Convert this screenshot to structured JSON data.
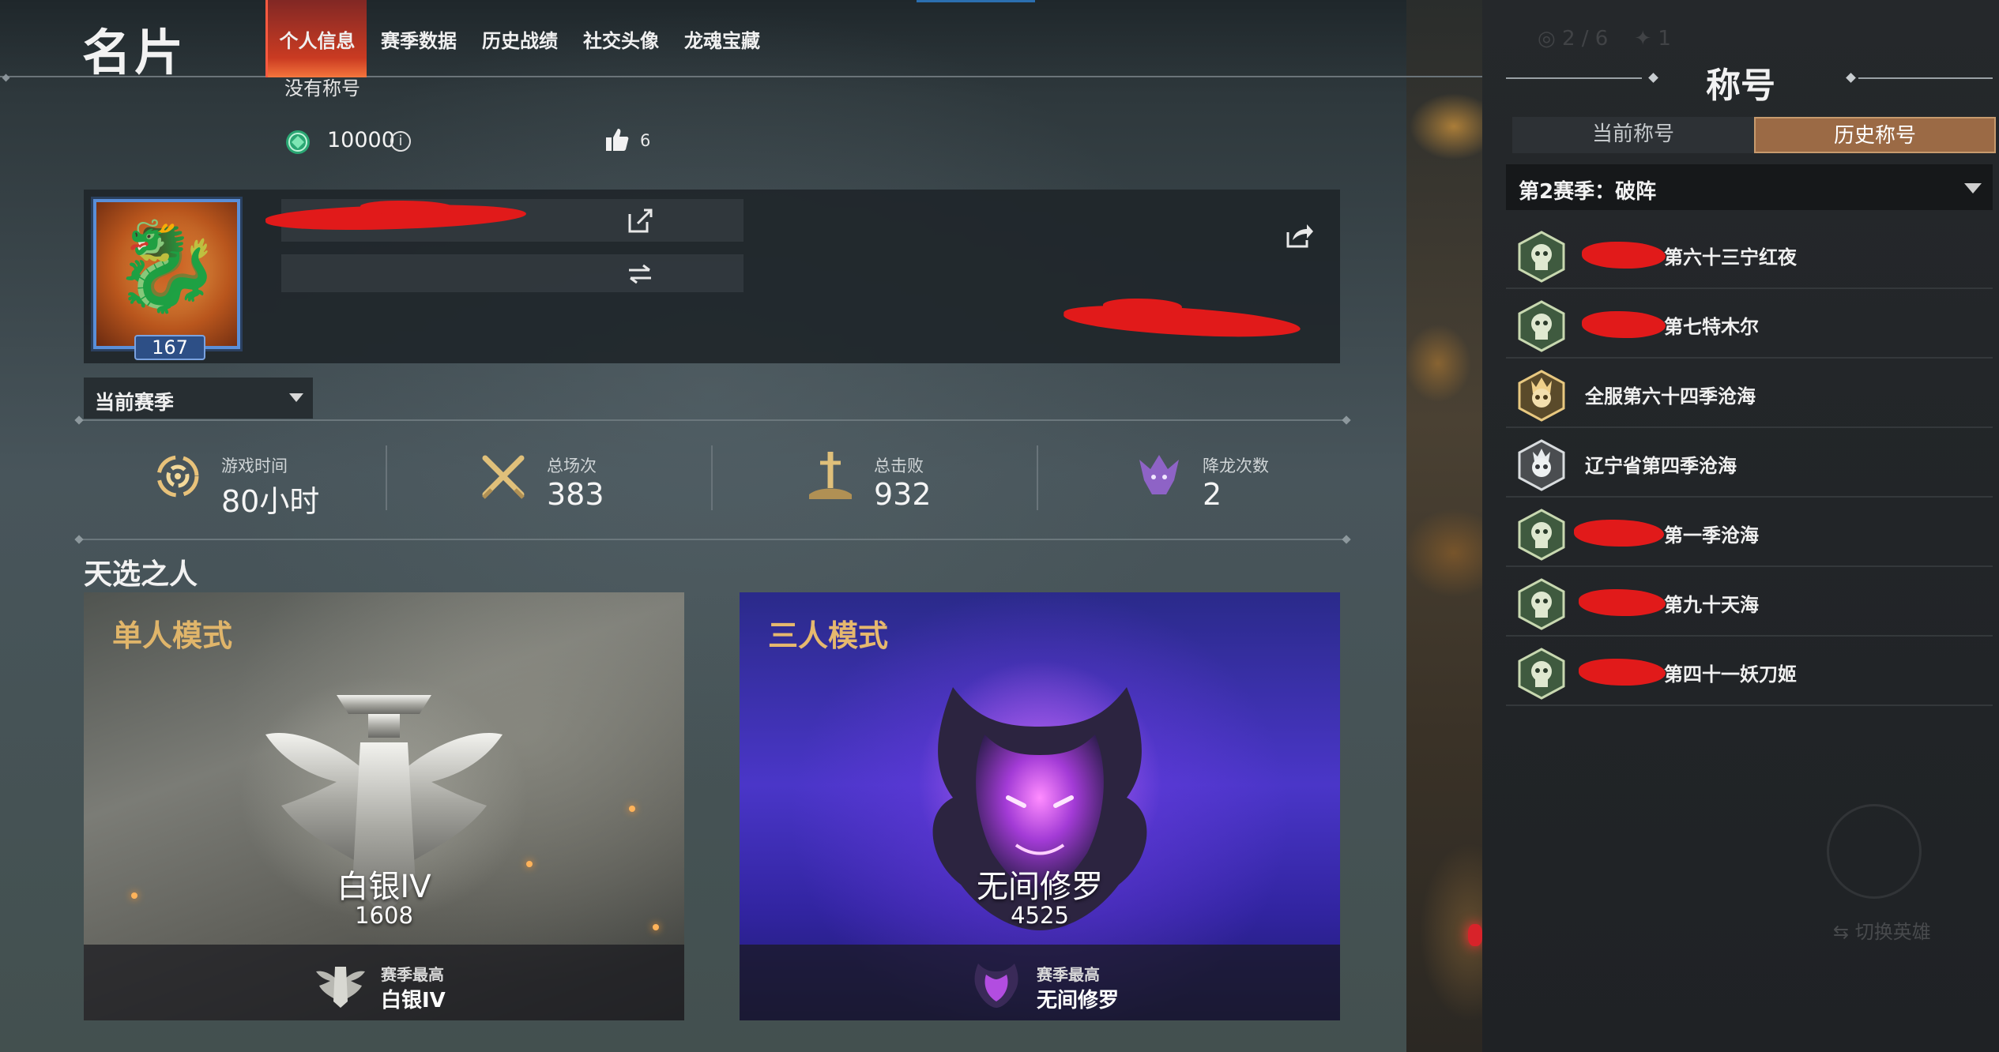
{
  "header": {
    "title": "名片",
    "tabs": [
      {
        "label": "个人信息",
        "active": true
      },
      {
        "label": "赛季数据",
        "active": false
      },
      {
        "label": "历史战绩",
        "active": false
      },
      {
        "label": "社交头像",
        "active": false
      },
      {
        "label": "龙魂宝藏",
        "active": false
      }
    ]
  },
  "profile": {
    "level": "167",
    "title_text": "没有称号",
    "coins": "10000",
    "likes": "6"
  },
  "season_select": {
    "label": "当前赛季"
  },
  "stats": [
    {
      "label": "游戏时间",
      "value": "80小时",
      "icon": "swirl-icon"
    },
    {
      "label": "总场次",
      "value": "383",
      "icon": "crossed-swords-icon"
    },
    {
      "label": "总击败",
      "value": "932",
      "icon": "sword-in-ground-icon"
    },
    {
      "label": "降龙次数",
      "value": "2",
      "icon": "dragon-head-icon"
    }
  ],
  "chosen": {
    "title": "天选之人",
    "modes": [
      {
        "name": "单人模式",
        "rank": "白银IV",
        "score": "1608",
        "best_label": "赛季最高",
        "best_rank": "白银IV"
      },
      {
        "name": "三人模式",
        "rank": "无间修罗",
        "score": "4525",
        "best_label": "赛季最高",
        "best_rank": "无间修罗"
      }
    ]
  },
  "titles_panel": {
    "title": "称号",
    "tabs": [
      {
        "label": "当前称号",
        "active": false
      },
      {
        "label": "历史称号",
        "active": true
      }
    ],
    "season": "第2赛季：破阵",
    "items": [
      {
        "text": "第六十三宁红夜",
        "badge": "green"
      },
      {
        "text": "第七特木尔",
        "badge": "green"
      },
      {
        "text": "全服第六十四季沧海",
        "badge": "gold"
      },
      {
        "text": "辽宁省第四季沧海",
        "badge": "silver"
      },
      {
        "text": "第一季沧海",
        "badge": "green"
      },
      {
        "text": "第九十天海",
        "badge": "green"
      },
      {
        "text": "第四十一妖刀姬",
        "badge": "green"
      }
    ],
    "background_hint": "切换英雄"
  },
  "colors": {
    "active_tab": "#e0402c",
    "history_tab": "#9b6a45",
    "solo_mode_label": "#e0b56a",
    "level_badge": "#2d4f86"
  }
}
